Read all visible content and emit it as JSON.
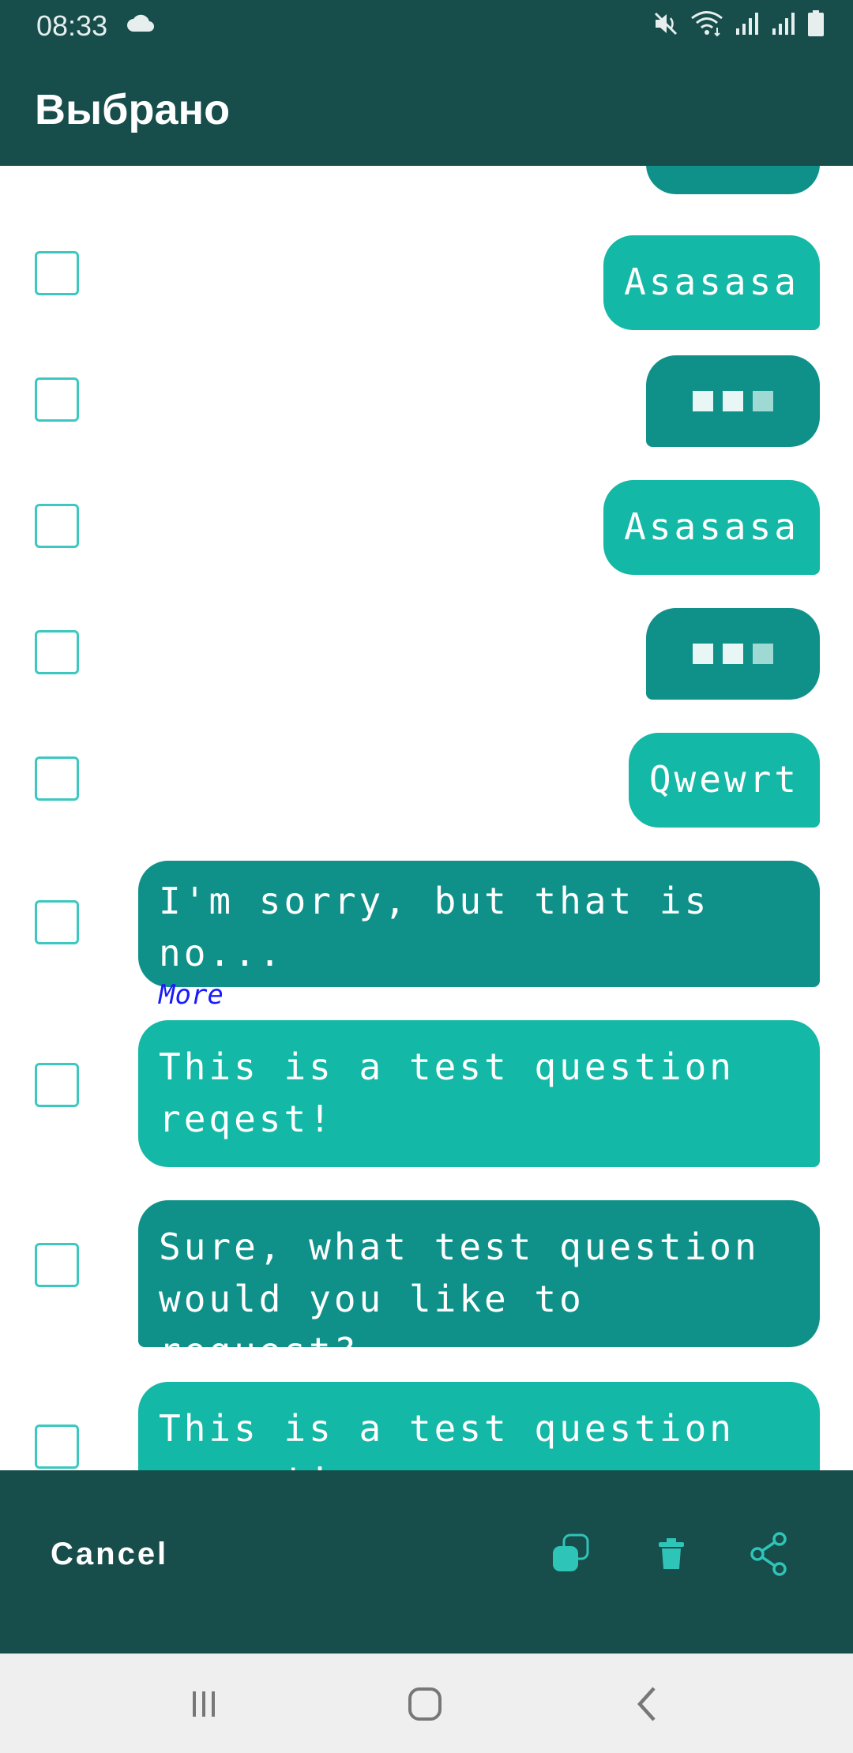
{
  "status_bar": {
    "time": "08:33"
  },
  "app_bar": {
    "title": "Выбрано"
  },
  "messages": [
    {
      "text": "Asasasa"
    },
    {
      "text": "Asasasa"
    },
    {
      "text": "Qwewrt"
    },
    {
      "text": "I'm sorry, but that is no...",
      "more": "More"
    },
    {
      "text": "This is a test question\nreqest!"
    },
    {
      "text": "Sure, what test question\nwould you like to request?"
    },
    {
      "text": "This is a test question\nreqest!"
    }
  ],
  "bottom_bar": {
    "cancel_label": "Cancel"
  },
  "colors": {
    "primary_dark": "#174d4a",
    "bubble_outgoing": "#14b8a6",
    "bubble_incoming": "#0f918a",
    "checkbox_border": "#3cc8c0",
    "link": "#1a1aff"
  },
  "icons": [
    "cloud-icon",
    "mute-icon",
    "wifi-icon",
    "signal-icon",
    "battery-icon",
    "copy-icon",
    "trash-icon",
    "share-icon",
    "recents-icon",
    "home-icon",
    "back-icon"
  ]
}
